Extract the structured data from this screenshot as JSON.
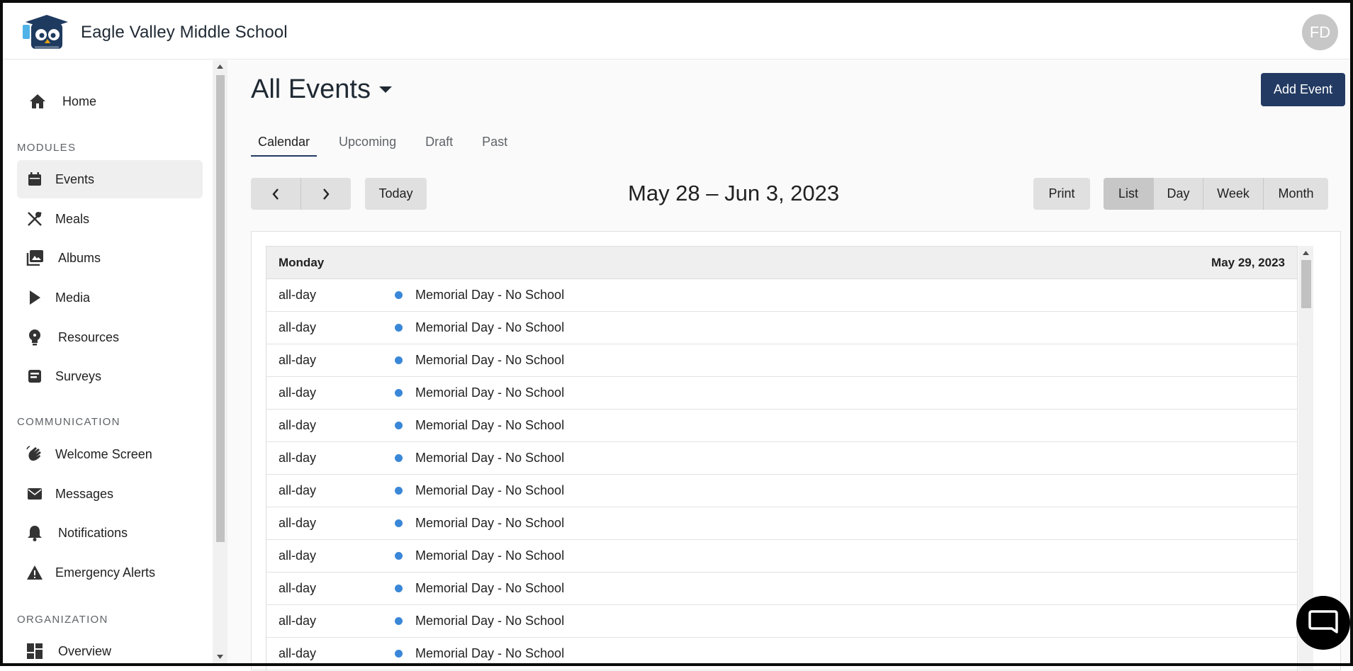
{
  "header": {
    "school_name": "Eagle Valley Middle School",
    "avatar_initials": "FD"
  },
  "sidebar": {
    "home_label": "Home",
    "sections": {
      "modules": "MODULES",
      "communication": "COMMUNICATION",
      "organization": "ORGANIZATION"
    },
    "items": [
      {
        "label": "Events",
        "icon": "calendar-icon"
      },
      {
        "label": "Meals",
        "icon": "utensils-icon"
      },
      {
        "label": "Albums",
        "icon": "photo-album-icon"
      },
      {
        "label": "Media",
        "icon": "play-icon"
      },
      {
        "label": "Resources",
        "icon": "lightbulb-icon"
      },
      {
        "label": "Surveys",
        "icon": "survey-icon"
      },
      {
        "label": "Welcome Screen",
        "icon": "wave-hand-icon"
      },
      {
        "label": "Messages",
        "icon": "envelope-icon"
      },
      {
        "label": "Notifications",
        "icon": "bell-icon"
      },
      {
        "label": "Emergency Alerts",
        "icon": "warning-icon"
      },
      {
        "label": "Overview",
        "icon": "dashboard-icon"
      }
    ]
  },
  "main": {
    "title": "All Events",
    "add_button": "Add Event",
    "tabs": [
      "Calendar",
      "Upcoming",
      "Draft",
      "Past"
    ],
    "today_button": "Today",
    "date_range": "May 28 – Jun 3, 2023",
    "print_button": "Print",
    "views": [
      "List",
      "Day",
      "Week",
      "Month"
    ],
    "active_view": "List",
    "day_header": {
      "day": "Monday",
      "date": "May 29, 2023"
    },
    "events": [
      {
        "time": "all-day",
        "title": "Memorial Day - No School"
      },
      {
        "time": "all-day",
        "title": "Memorial Day - No School"
      },
      {
        "time": "all-day",
        "title": "Memorial Day - No School"
      },
      {
        "time": "all-day",
        "title": "Memorial Day - No School"
      },
      {
        "time": "all-day",
        "title": "Memorial Day - No School"
      },
      {
        "time": "all-day",
        "title": "Memorial Day - No School"
      },
      {
        "time": "all-day",
        "title": "Memorial Day - No School"
      },
      {
        "time": "all-day",
        "title": "Memorial Day - No School"
      },
      {
        "time": "all-day",
        "title": "Memorial Day - No School"
      },
      {
        "time": "all-day",
        "title": "Memorial Day - No School"
      },
      {
        "time": "all-day",
        "title": "Memorial Day - No School"
      },
      {
        "time": "all-day",
        "title": "Memorial Day - No School"
      }
    ]
  },
  "colors": {
    "primary": "#233b63",
    "event_dot": "#3a87d8"
  }
}
